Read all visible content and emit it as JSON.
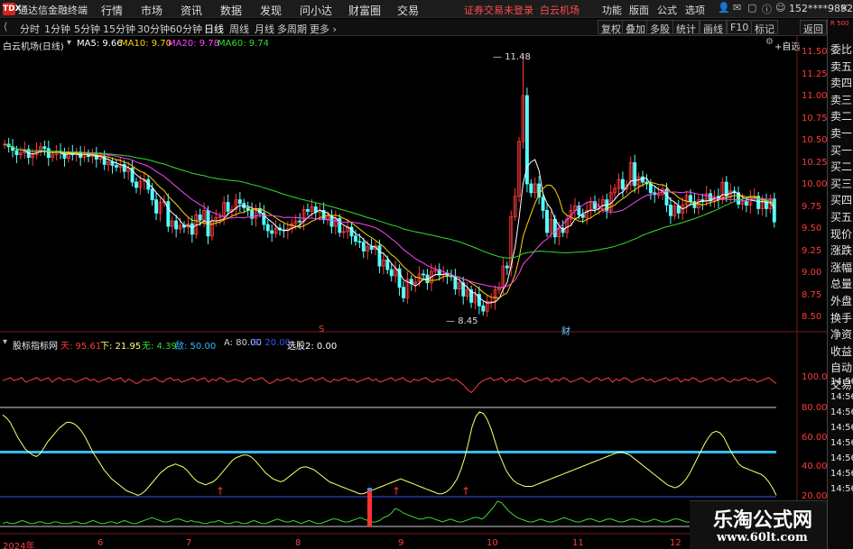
{
  "app": {
    "title": "通达信金融终端",
    "logo": "TDX",
    "warning": "证券交易未登录",
    "stock_name": "白云机场",
    "account": "152****9892"
  },
  "main_menu": [
    "行情",
    "市场",
    "资讯",
    "数据",
    "发现",
    "问小达",
    "财富圈",
    "交易"
  ],
  "right_menu": [
    "功能",
    "版面",
    "公式",
    "选项"
  ],
  "periods": [
    "分时",
    "1分钟",
    "5分钟",
    "15分钟",
    "30分钟",
    "60分钟",
    "日线",
    "周线",
    "月线",
    "多周期",
    "更多"
  ],
  "period_active": "日线",
  "tool_buttons": [
    "复权",
    "叠加",
    "多股",
    "统计",
    "画线",
    "F10",
    "标记",
    "返回"
  ],
  "tool_add": "+自选",
  "price_panel": {
    "header": "白云机场(日线)",
    "ma": [
      {
        "label": "MA5: 9.66",
        "color": "#ffffff"
      },
      {
        "label": "MA10: 9.70",
        "color": "#ffd400"
      },
      {
        "label": "MA20: 9.78",
        "color": "#ff44ff"
      },
      {
        "label": "MA60: 9.74",
        "color": "#33dd33"
      }
    ],
    "high_label": "11.48",
    "low_label": "8.45",
    "marker_s": "S",
    "marker_cai": "财"
  },
  "indicator_panel": {
    "header": "股标指标网",
    "items": [
      {
        "label": "天: 95.61",
        "color": "#ff3b3b"
      },
      {
        "label": "下: 21.95",
        "color": "#ffff66"
      },
      {
        "label": "无: 4.39",
        "color": "#33dd33"
      },
      {
        "label": "敌: 50.00",
        "color": "#33bbff"
      },
      {
        "label": "A: 80.00",
        "color": "#d0d0d0"
      },
      {
        "label": "B: 20.00",
        "color": "#3355ff"
      },
      {
        "label": "选股2: 0.00",
        "color": "#ffffff"
      }
    ]
  },
  "right_panel": {
    "badge": "R 500",
    "items": [
      "委比",
      "卖五",
      "卖四",
      "卖三",
      "卖二",
      "卖一",
      "买一",
      "买二",
      "买三",
      "买四",
      "买五",
      "现价",
      "涨跌",
      "涨幅",
      "总量",
      "外盘",
      "换手",
      "净资",
      "收益",
      "自动",
      "交易",
      "14:56",
      "14:56",
      "14:56",
      "14:56",
      "14:56",
      "14:56",
      "14:56",
      "14:56"
    ]
  },
  "watermark": {
    "text": "乐淘公式网",
    "url": "www.60lt.com"
  },
  "chart_data": [
    {
      "type": "candlestick",
      "title": "白云机场(日线)",
      "y_ticks": [
        "11.50",
        "11.25",
        "11.00",
        "10.75",
        "10.50",
        "10.25",
        "10.00",
        "9.75",
        "9.50",
        "9.25",
        "9.00",
        "8.75",
        "8.50"
      ],
      "ylim": [
        8.4,
        11.6
      ],
      "x_ticks": [
        "2024年",
        "6",
        "7",
        "8",
        "9",
        "10",
        "11",
        "12"
      ],
      "annotations": [
        "11.48",
        "8.45"
      ],
      "up_color": "#ff3b3b",
      "down_color": "#54ffff",
      "close": [
        10.45,
        10.42,
        10.38,
        10.33,
        10.35,
        10.39,
        10.3,
        10.33,
        10.38,
        10.42,
        10.4,
        10.3,
        10.33,
        10.37,
        10.36,
        10.29,
        10.35,
        10.33,
        10.36,
        10.3,
        10.34,
        10.31,
        10.33,
        10.28,
        10.31,
        10.22,
        10.25,
        10.21,
        10.19,
        10.22,
        10.14,
        10.18,
        10.02,
        9.96,
        10.03,
        10.05,
        9.94,
        9.82,
        9.67,
        9.79,
        9.8,
        9.52,
        9.58,
        9.49,
        9.53,
        9.51,
        9.55,
        9.43,
        9.65,
        9.59,
        9.7,
        9.41,
        9.58,
        9.62,
        9.63,
        9.79,
        9.69,
        9.71,
        9.82,
        9.78,
        9.73,
        9.7,
        9.61,
        9.72,
        9.67,
        9.54,
        9.47,
        9.44,
        9.5,
        9.48,
        9.47,
        9.49,
        9.55,
        9.58,
        9.57,
        9.71,
        9.69,
        9.74,
        9.68,
        9.7,
        9.6,
        9.64,
        9.52,
        9.61,
        9.45,
        9.46,
        9.51,
        9.41,
        9.35,
        9.34,
        9.24,
        9.29,
        9.26,
        9.3,
        9.07,
        9.14,
        9.03,
        8.96,
        9.04,
        8.83,
        8.71,
        8.92,
        8.87,
        8.89,
        8.98,
        8.97,
        8.88,
        9.01,
        9.03,
        8.97,
        8.98,
        8.96,
        8.95,
        8.81,
        8.88,
        8.73,
        8.8,
        8.66,
        8.75,
        8.62,
        8.56,
        8.67,
        8.67,
        8.8,
        8.82,
        9.07,
        9.05,
        9.63,
        9.86,
        10.48,
        11.0,
        10.0,
        9.9,
        10.0,
        9.85,
        9.7,
        9.45,
        9.6,
        9.4,
        9.5,
        9.45,
        9.6,
        9.7,
        9.75,
        9.65,
        9.62,
        9.7,
        9.8,
        9.72,
        9.75,
        9.82,
        9.7,
        9.9,
        9.95,
        10.05,
        9.94,
        9.99,
        10.24,
        9.98,
        10.08,
        10.02,
        10.0,
        9.9,
        9.88,
        9.88,
        9.94,
        9.76,
        9.64,
        9.75,
        9.67,
        9.76,
        9.87,
        9.8,
        9.73,
        9.82,
        9.8,
        9.89,
        9.81,
        9.86,
        9.82,
        10.02,
        9.86,
        9.92,
        9.9,
        9.77,
        9.8,
        9.76,
        9.86,
        9.86,
        9.72,
        9.8,
        9.72,
        9.83,
        9.57
      ]
    },
    {
      "type": "line",
      "title": "股标指标网",
      "y_ticks": [
        "100.0",
        "80.00",
        "60.00",
        "40.00",
        "20.00"
      ],
      "ylim": [
        0,
        108
      ],
      "series": [
        {
          "name": "天",
          "color": "#ff3b3b",
          "values": [
            98,
            99,
            100,
            98,
            99,
            100,
            97,
            98,
            99,
            100,
            98,
            99,
            100,
            97,
            99,
            100,
            98,
            99,
            99,
            97,
            98,
            99,
            100,
            98,
            99,
            97,
            98,
            99,
            100,
            98,
            99,
            100,
            97,
            99,
            98,
            96,
            97,
            99,
            98,
            99,
            100,
            98,
            97,
            99,
            100,
            98,
            99,
            97,
            98,
            99,
            100,
            98,
            99,
            100,
            97,
            99,
            98,
            100,
            99,
            97,
            98,
            99,
            98,
            97,
            99,
            100,
            98,
            99,
            100,
            98,
            96,
            97,
            99,
            98,
            99,
            100,
            98,
            99,
            97,
            98,
            99,
            100,
            98,
            99,
            100,
            98,
            97,
            99,
            98,
            99,
            100,
            98,
            99,
            97,
            98,
            99,
            100,
            98,
            99,
            97,
            98,
            99,
            100,
            98,
            99,
            100,
            98,
            97,
            99,
            98,
            99,
            100,
            98,
            97,
            99,
            98,
            99,
            100,
            98,
            99,
            97,
            95,
            92,
            90,
            93,
            96,
            98,
            99,
            100,
            98,
            99,
            100,
            97,
            99,
            98,
            100,
            99,
            97,
            98,
            99,
            100,
            98,
            99,
            100,
            97,
            99,
            98,
            100,
            99,
            97,
            98,
            99,
            100,
            98,
            97,
            99,
            100,
            98,
            99,
            100,
            97,
            99,
            98,
            100,
            99,
            97,
            98,
            99,
            100,
            98,
            99,
            97,
            98,
            99,
            100,
            98,
            99,
            100,
            97,
            99,
            98,
            100,
            99,
            97,
            98,
            99,
            100,
            98,
            99,
            100,
            98,
            97,
            99,
            98,
            99,
            100,
            98,
            99,
            97,
            98,
            99,
            100,
            98,
            96
          ]
        },
        {
          "name": "下",
          "color": "#ffff66",
          "values": [
            75,
            73,
            70,
            65,
            60,
            56,
            52,
            50,
            48,
            47,
            49,
            53,
            57,
            60,
            63,
            66,
            68,
            70,
            70,
            69,
            67,
            64,
            60,
            55,
            50,
            46,
            42,
            38,
            35,
            32,
            30,
            28,
            26,
            24,
            23,
            22,
            21,
            22,
            24,
            27,
            30,
            33,
            36,
            38,
            40,
            41,
            42,
            41,
            40,
            38,
            35,
            32,
            30,
            29,
            28,
            29,
            30,
            32,
            35,
            38,
            41,
            44,
            46,
            47,
            48,
            48,
            47,
            45,
            42,
            39,
            36,
            34,
            32,
            31,
            30,
            31,
            33,
            35,
            37,
            39,
            40,
            40,
            39,
            38,
            36,
            34,
            32,
            30,
            29,
            28,
            27,
            26,
            25,
            24,
            23,
            22,
            22,
            23,
            24,
            25,
            26,
            27,
            28,
            29,
            30,
            31,
            32,
            31,
            30,
            29,
            28,
            27,
            26,
            25,
            24,
            23,
            22,
            22,
            23,
            25,
            28,
            32,
            38,
            46,
            56,
            67,
            74,
            77,
            76,
            72,
            66,
            58,
            50,
            44,
            38,
            34,
            31,
            29,
            28,
            27,
            27,
            27,
            28,
            29,
            30,
            31,
            32,
            33,
            34,
            35,
            36,
            37,
            38,
            39,
            40,
            41,
            42,
            43,
            44,
            45,
            46,
            47,
            48,
            49,
            50,
            50,
            49,
            48,
            46,
            44,
            42,
            40,
            38,
            36,
            34,
            32,
            30,
            28,
            27,
            26,
            27,
            29,
            32,
            36,
            41,
            46,
            51,
            56,
            60,
            63,
            64,
            63,
            60,
            55,
            50,
            46,
            42,
            40,
            39,
            38,
            37,
            36,
            35,
            33,
            30,
            26,
            21
          ]
        },
        {
          "name": "无",
          "color": "#33dd33",
          "values": [
            2,
            3,
            2,
            2,
            3,
            4,
            3,
            2,
            2,
            3,
            3,
            2,
            2,
            3,
            3,
            2,
            2,
            2,
            3,
            3,
            2,
            2,
            3,
            4,
            3,
            2,
            2,
            3,
            3,
            2,
            3,
            4,
            3,
            2,
            2,
            3,
            4,
            5,
            6,
            5,
            4,
            3,
            3,
            4,
            5,
            5,
            4,
            3,
            4,
            3,
            3,
            2,
            2,
            3,
            3,
            4,
            3,
            2,
            2,
            3,
            3,
            2,
            2,
            3,
            4,
            3,
            2,
            2,
            3,
            4,
            5,
            4,
            3,
            3,
            4,
            3,
            2,
            3,
            4,
            3,
            2,
            2,
            3,
            4,
            5,
            5,
            4,
            3,
            3,
            4,
            5,
            6,
            5,
            4,
            3,
            3,
            4,
            6,
            7,
            9,
            12,
            11,
            9,
            8,
            7,
            6,
            5,
            5,
            6,
            6,
            5,
            4,
            3,
            4,
            5,
            4,
            3,
            3,
            4,
            5,
            6,
            6,
            5,
            7,
            10,
            13,
            17,
            16,
            13,
            10,
            8,
            6,
            5,
            4,
            3,
            3,
            4,
            5,
            4,
            3,
            3,
            4,
            5,
            6,
            5,
            4,
            3,
            3,
            4,
            5,
            5,
            4,
            3,
            4,
            5,
            5,
            4,
            3,
            3,
            4,
            5,
            5,
            4,
            3,
            3,
            4,
            5,
            4,
            3,
            3,
            4,
            5,
            5,
            4,
            3,
            3,
            4,
            4,
            3,
            3,
            3,
            3,
            4,
            4,
            3,
            3,
            2,
            2,
            3,
            3,
            4,
            4,
            3,
            3,
            3,
            4,
            4,
            3
          ]
        },
        {
          "name": "A",
          "color": "#d0d0d0",
          "values": [
            80
          ]
        },
        {
          "name": "B",
          "color": "#3355ff",
          "values": [
            20
          ]
        },
        {
          "name": "敌",
          "color": "#33bbff",
          "values": [
            50
          ]
        }
      ],
      "arrows": [
        "↑",
        "↑",
        "↑",
        "↑"
      ]
    }
  ]
}
